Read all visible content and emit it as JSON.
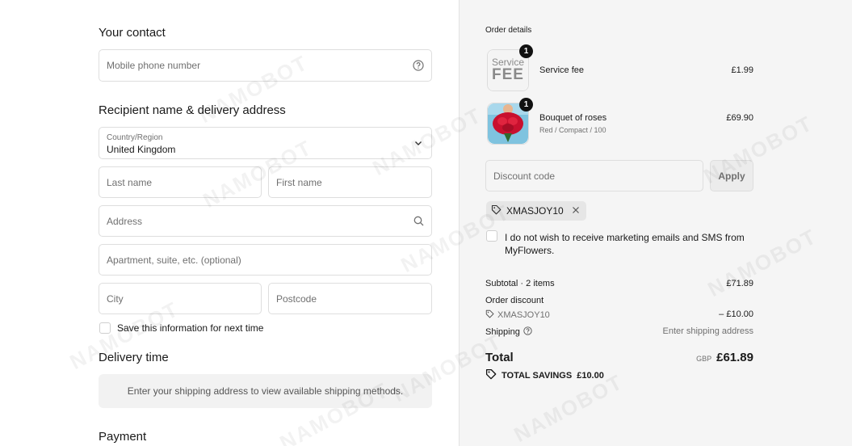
{
  "contact": {
    "heading": "Your contact",
    "phone_placeholder": "Mobile phone number"
  },
  "delivery": {
    "heading": "Recipient name & delivery address",
    "country_label": "Country/Region",
    "country_value": "United Kingdom",
    "last_name_placeholder": "Last name",
    "first_name_placeholder": "First name",
    "address_placeholder": "Address",
    "apartment_placeholder": "Apartment, suite, etc. (optional)",
    "city_placeholder": "City",
    "postcode_placeholder": "Postcode",
    "save_info_label": "Save this information for next time"
  },
  "delivery_time": {
    "heading": "Delivery time",
    "notice": "Enter your shipping address to view available shipping methods."
  },
  "payment": {
    "heading": "Payment"
  },
  "order": {
    "title": "Order details",
    "items": [
      {
        "name": "Service fee",
        "variant": "",
        "price": "£1.99",
        "quantity": "1",
        "thumb_line1": "Service",
        "thumb_line2": "FEE"
      },
      {
        "name": "Bouquet of roses",
        "variant": "Red / Compact / 100",
        "price": "£69.90",
        "quantity": "1"
      }
    ],
    "discount_placeholder": "Discount code",
    "apply_label": "Apply",
    "applied_code": "XMASJOY10",
    "marketing_label": "I do not wish to receive marketing emails and SMS from MyFlowers.",
    "subtotal_label": "Subtotal · 2 items",
    "subtotal_value": "£71.89",
    "order_discount_label": "Order discount",
    "discount_code": "XMASJOY10",
    "discount_value": "– £10.00",
    "shipping_label": "Shipping",
    "shipping_value": "Enter shipping address",
    "total_label": "Total",
    "currency": "GBP",
    "total_value": "£61.89",
    "savings_label": "TOTAL SAVINGS",
    "savings_value": "£10.00"
  },
  "watermark": "NAMOBOT"
}
